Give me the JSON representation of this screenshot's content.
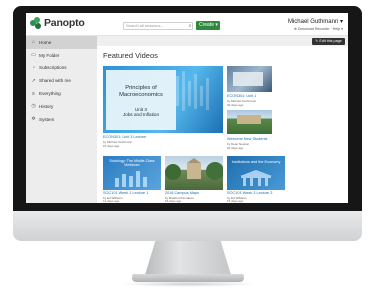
{
  "app": {
    "brand": "Panopto",
    "accent": "#2f8a3e"
  },
  "header": {
    "search_placeholder": "Search all sessions...",
    "create_label": "Create ▾",
    "user_name": "Michael Guthmann ▾",
    "user_links": "⊕ Download Recorder · Help ▾"
  },
  "sidebar": {
    "items": [
      {
        "label": "Home",
        "icon": "home-icon",
        "glyph": "⌂"
      },
      {
        "label": "My Folder",
        "icon": "folder-icon",
        "glyph": "▭"
      },
      {
        "label": "Subscriptions",
        "icon": "bell-icon",
        "glyph": "◔"
      },
      {
        "label": "Shared with me",
        "icon": "share-icon",
        "glyph": "↗"
      },
      {
        "label": "Everything",
        "icon": "stack-icon",
        "glyph": "≡"
      },
      {
        "label": "History",
        "icon": "clock-icon",
        "glyph": "◷"
      },
      {
        "label": "System",
        "icon": "gear-icon",
        "glyph": "✲"
      }
    ]
  },
  "main": {
    "edit_label": "✎ Edit this page",
    "section_title": "Featured Videos",
    "featured": {
      "thumb_title": "Principles of Macroeconomics",
      "thumb_subtitle": "Unit 3\nJobs and Inflation",
      "title": "ECON301: Unit 3 Lecture",
      "author": "by Michael Guthmann",
      "age": "15 days ago"
    },
    "side_cards": [
      {
        "title": "ECON301: Unit 1",
        "author": "by Michael Guthmann",
        "age": "30 days ago"
      },
      {
        "title": "Welcome New Students",
        "author": "by Dean Newton",
        "age": "30 days ago"
      }
    ],
    "bottom_cards": [
      {
        "thumb_text": "Sociology: The Middle-Class Meltdown",
        "title": "SOC101 Week 1 Lecture 1",
        "author": "by Ed Williams",
        "age": "14 days ago"
      },
      {
        "thumb_text": "",
        "title": "2016 Campus Maps",
        "author": "by Bradford Donalson",
        "age": "15 days ago"
      },
      {
        "thumb_text": "Institutions and the Economy",
        "title": "SOC101 Week 3 Lecture 3",
        "author": "by Ed Williams",
        "age": "15 days ago"
      }
    ]
  }
}
